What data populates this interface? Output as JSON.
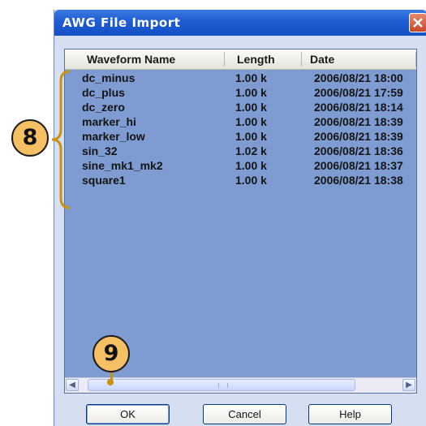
{
  "window": {
    "title": "AWG File Import"
  },
  "list": {
    "columns": [
      "Waveform Name",
      "Length",
      "Date"
    ],
    "rows": [
      {
        "name": "dc_minus",
        "length": "1.00 k",
        "date": "2006/08/21 18:00"
      },
      {
        "name": "dc_plus",
        "length": "1.00 k",
        "date": "2006/08/21 17:59"
      },
      {
        "name": "dc_zero",
        "length": "1.00 k",
        "date": "2006/08/21 18:14"
      },
      {
        "name": "marker_hi",
        "length": "1.00 k",
        "date": "2006/08/21 18:39"
      },
      {
        "name": "marker_low",
        "length": "1.00 k",
        "date": "2006/08/21 18:39"
      },
      {
        "name": "sin_32",
        "length": "1.02 k",
        "date": "2006/08/21 18:36"
      },
      {
        "name": "sine_mk1_mk2",
        "length": "1.00 k",
        "date": "2006/08/21 18:37"
      },
      {
        "name": "square1",
        "length": "1.00 k",
        "date": "2006/08/21 18:38"
      }
    ]
  },
  "buttons": {
    "ok": "OK",
    "cancel": "Cancel",
    "help": "Help"
  },
  "callouts": {
    "step8": "8",
    "step9": "9"
  },
  "icons": {
    "close": "close-icon",
    "scroll_left": "scroll-left-icon",
    "scroll_right": "scroll-right-icon"
  },
  "colors": {
    "title_bar": "#1e5cd3",
    "list_background": "#7f9cd2",
    "callout_fill": "#f5c064",
    "bracket": "#c9920f"
  }
}
